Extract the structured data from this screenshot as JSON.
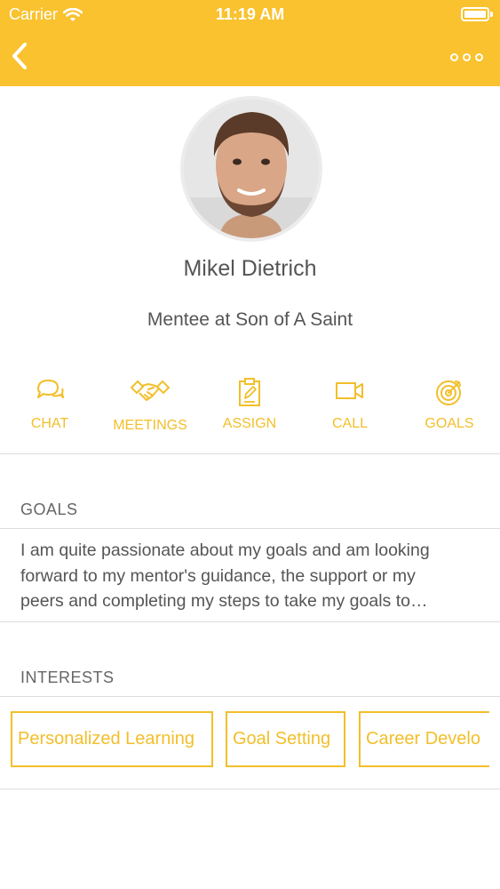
{
  "status_bar": {
    "carrier": "Carrier",
    "time": "11:19 AM"
  },
  "nav": {
    "back_icon": "chevron-left-icon",
    "more_icon": "more-dots-icon"
  },
  "profile": {
    "name": "Mikel Dietrich",
    "role": "Mentee at Son of A Saint"
  },
  "actions": [
    {
      "label": "CHAT",
      "icon": "chat-bubbles-icon"
    },
    {
      "label": "MEETINGS",
      "icon": "handshake-icon"
    },
    {
      "label": "ASSIGN",
      "icon": "clipboard-icon"
    },
    {
      "label": "CALL",
      "icon": "video-camera-icon"
    },
    {
      "label": "GOALS",
      "icon": "target-icon"
    }
  ],
  "goals": {
    "title": "GOALS",
    "text_lines": [
      "I am quite passionate about my goals and am looking",
      "forward to my mentor's guidance, the support or my",
      "peers and completing my steps to take my goals to…"
    ]
  },
  "interests": {
    "title": "INTERESTS",
    "chips": [
      "Personalized Learning",
      "Goal Setting",
      "Career Develo"
    ]
  },
  "colors": {
    "accent": "#F9C22E",
    "label": "#F2BF2A",
    "text": "#555555"
  }
}
